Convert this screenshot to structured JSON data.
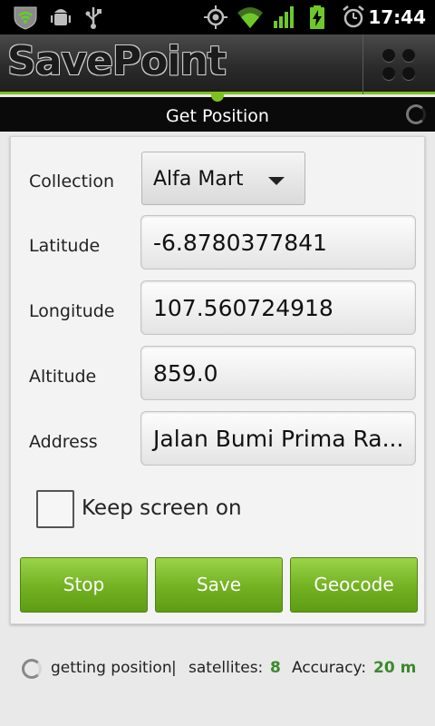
{
  "status_bar": {
    "time": "17:44",
    "left_icons": [
      "shield-wifi-icon",
      "android-debug-icon",
      "usb-icon"
    ],
    "right_icons": [
      "gps-icon",
      "wifi-signal-icon",
      "cell-signal-icon",
      "battery-charging-icon",
      "alarm-icon"
    ]
  },
  "app": {
    "logo": "SavePoint",
    "menu_icon": "four-dots-menu-icon",
    "accent": "#7fbf1e"
  },
  "screen": {
    "title": "Get Position"
  },
  "form": {
    "collection": {
      "label": "Collection",
      "value": "Alfa Mart"
    },
    "latitude": {
      "label": "Latitude",
      "value": "-6.8780377841"
    },
    "longitude": {
      "label": "Longitude",
      "value": "107.560724918"
    },
    "altitude": {
      "label": "Altitude",
      "value": "859.0"
    },
    "address": {
      "label": "Address",
      "value": "Jalan Bumi Prima Ra..."
    },
    "keep_screen_on": {
      "label": "Keep screen on",
      "checked": false
    }
  },
  "buttons": {
    "stop": "Stop",
    "save": "Save",
    "geocode": "Geocode"
  },
  "footer": {
    "status": "getting position",
    "separator": "|",
    "satellites_label": "satellites:",
    "satellites_value": "8",
    "accuracy_label": "Accuracy:",
    "accuracy_value": "20 m"
  }
}
